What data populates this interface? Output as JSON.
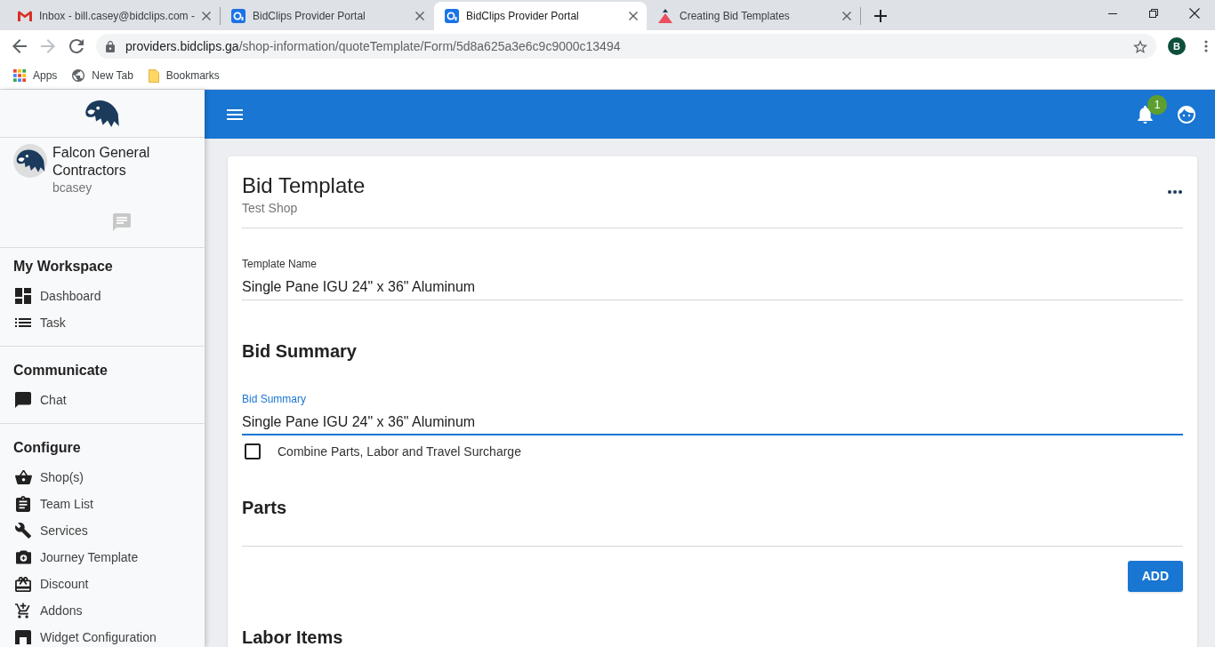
{
  "browser": {
    "tabs": [
      {
        "title": "Inbox - bill.casey@bidclips.com -",
        "selected": false
      },
      {
        "title": "BidClips Provider Portal",
        "selected": false
      },
      {
        "title": "BidClips Provider Portal",
        "selected": true
      },
      {
        "title": "Creating Bid Templates",
        "selected": false
      }
    ],
    "address": {
      "host": "providers.bidclips.ga",
      "path": "/shop-information/quoteTemplate/Form/5d8a625a3e6c9c9000c13494"
    },
    "profile_initial": "B",
    "bookmarks": [
      "Apps",
      "New Tab",
      "Bookmarks"
    ]
  },
  "header": {
    "notification_count": "1"
  },
  "sidebar": {
    "company": "Falcon General Contractors",
    "username": "bcasey",
    "sections": [
      {
        "title": "My Workspace",
        "items": [
          "Dashboard",
          "Task"
        ]
      },
      {
        "title": "Communicate",
        "items": [
          "Chat"
        ]
      },
      {
        "title": "Configure",
        "items": [
          "Shop(s)",
          "Team List",
          "Services",
          "Journey Template",
          "Discount",
          "Addons",
          "Widget Configuration"
        ]
      }
    ]
  },
  "card": {
    "title": "Bid Template",
    "subtitle": "Test Shop",
    "content": [
      {
        "kind": "field",
        "label": "Template Name",
        "value": "Single Pane IGU 24\" x 36\" Aluminum",
        "focused": false
      },
      {
        "kind": "heading",
        "text": "Bid Summary"
      },
      {
        "kind": "field",
        "label": "Bid Summary",
        "value": "Single Pane IGU 24\" x 36\" Aluminum",
        "focused": true
      },
      {
        "kind": "checkbox",
        "label": "Combine Parts, Labor and Travel Surcharge",
        "checked": false
      },
      {
        "kind": "heading",
        "text": "Parts"
      },
      {
        "kind": "divider"
      },
      {
        "kind": "button",
        "label": "ADD"
      },
      {
        "kind": "heading",
        "text": "Labor Items"
      }
    ]
  }
}
